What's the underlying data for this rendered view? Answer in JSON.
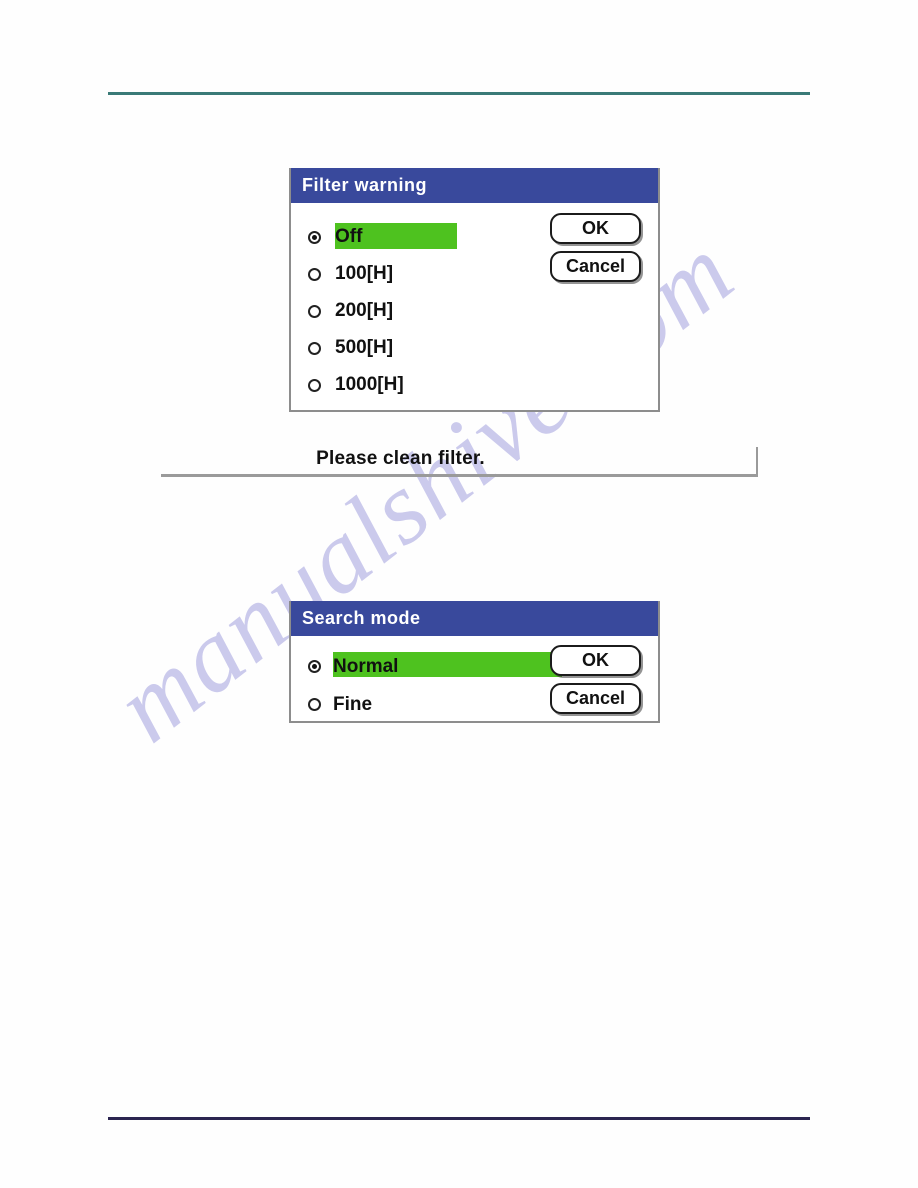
{
  "page": {
    "background_color": "#ffffff",
    "top_rule_color": "#3a7a77",
    "bottom_rule_color": "#2b2550",
    "watermark_text": "manualshive.com",
    "watermark_color": "#c9c8ec"
  },
  "theme": {
    "title_bar_color": "#39499c",
    "highlight_green": "#4ec21f",
    "dialog_border": "#8d8d8d",
    "button_border": "#1b1b1b"
  },
  "dialogs": [
    {
      "id": "filter-warning",
      "title": "Filter warning",
      "selected_index": 0,
      "options": [
        {
          "label": "Off",
          "checked": true
        },
        {
          "label": "100[H]",
          "checked": false
        },
        {
          "label": "200[H]",
          "checked": false
        },
        {
          "label": "500[H]",
          "checked": false
        },
        {
          "label": "1000[H]",
          "checked": false
        }
      ],
      "buttons": [
        {
          "label": "OK"
        },
        {
          "label": "Cancel"
        }
      ]
    },
    {
      "id": "search-mode",
      "title": "Search mode",
      "selected_index": 0,
      "options": [
        {
          "label": "Normal",
          "checked": true
        },
        {
          "label": "Fine",
          "checked": false
        }
      ],
      "buttons": [
        {
          "label": "OK"
        },
        {
          "label": "Cancel"
        }
      ]
    }
  ],
  "message_box": {
    "text": "Please clean filter."
  }
}
